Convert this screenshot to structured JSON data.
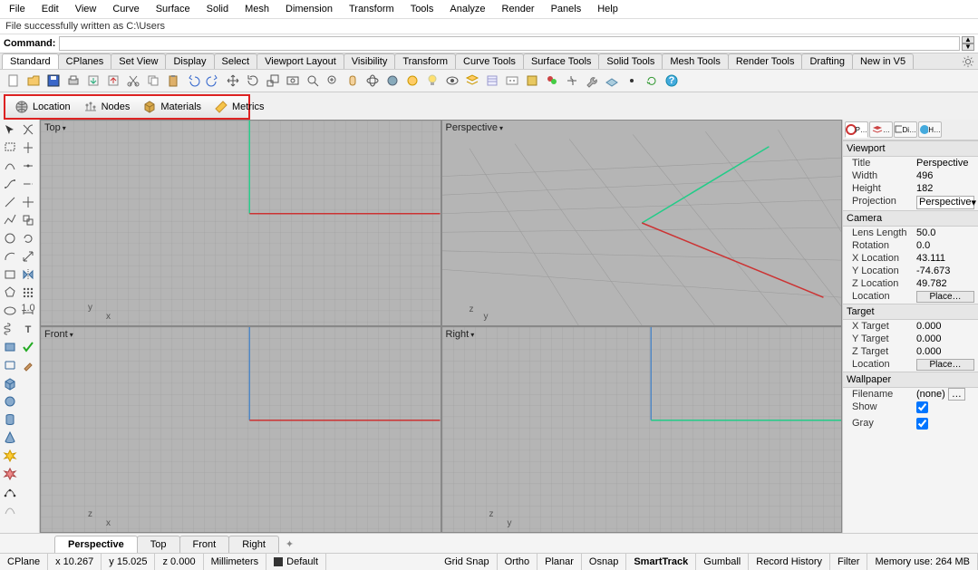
{
  "menu": {
    "items": [
      "File",
      "Edit",
      "View",
      "Curve",
      "Surface",
      "Solid",
      "Mesh",
      "Dimension",
      "Transform",
      "Tools",
      "Analyze",
      "Render",
      "Panels",
      "Help"
    ]
  },
  "status_line": "File successfully written as C:\\Users",
  "command": {
    "label": "Command:",
    "value": ""
  },
  "toolbar_tabs": [
    "Standard",
    "CPlanes",
    "Set View",
    "Display",
    "Select",
    "Viewport Layout",
    "Visibility",
    "Transform",
    "Curve Tools",
    "Surface Tools",
    "Solid Tools",
    "Mesh Tools",
    "Render Tools",
    "Drafting",
    "New in V5"
  ],
  "plugin_bar": {
    "items": [
      "Location",
      "Nodes",
      "Materials",
      "Metrics"
    ]
  },
  "viewports": {
    "tl": "Top",
    "tr": "Perspective",
    "bl": "Front",
    "br": "Right"
  },
  "viewport_tabs": [
    "Perspective",
    "Top",
    "Front",
    "Right"
  ],
  "props": {
    "tabs": [
      "P…",
      "…",
      "Di…",
      "H…"
    ],
    "viewport": {
      "header": "Viewport",
      "title_k": "Title",
      "title_v": "Perspective",
      "width_k": "Width",
      "width_v": "496",
      "height_k": "Height",
      "height_v": "182",
      "proj_k": "Projection",
      "proj_v": "Perspective"
    },
    "camera": {
      "header": "Camera",
      "lens_k": "Lens Length",
      "lens_v": "50.0",
      "rot_k": "Rotation",
      "rot_v": "0.0",
      "xk": "X Location",
      "xv": "43.111",
      "yk": "Y Location",
      "yv": "-74.673",
      "zk": "Z Location",
      "zv": "49.782",
      "loc_k": "Location",
      "loc_btn": "Place…"
    },
    "target": {
      "header": "Target",
      "xk": "X Target",
      "xv": "0.000",
      "yk": "Y Target",
      "yv": "0.000",
      "zk": "Z Target",
      "zv": "0.000",
      "loc_k": "Location",
      "loc_btn": "Place…"
    },
    "wallpaper": {
      "header": "Wallpaper",
      "file_k": "Filename",
      "file_v": "(none)",
      "show_k": "Show",
      "gray_k": "Gray"
    }
  },
  "statusbar": {
    "cplane": "CPlane",
    "x": "x 10.267",
    "y": "y 15.025",
    "z": "z 0.000",
    "units": "Millimeters",
    "layer": "Default",
    "toggles": [
      "Grid Snap",
      "Ortho",
      "Planar",
      "Osnap",
      "SmartTrack",
      "Gumball",
      "Record History",
      "Filter"
    ],
    "mem": "Memory use: 264 MB"
  }
}
